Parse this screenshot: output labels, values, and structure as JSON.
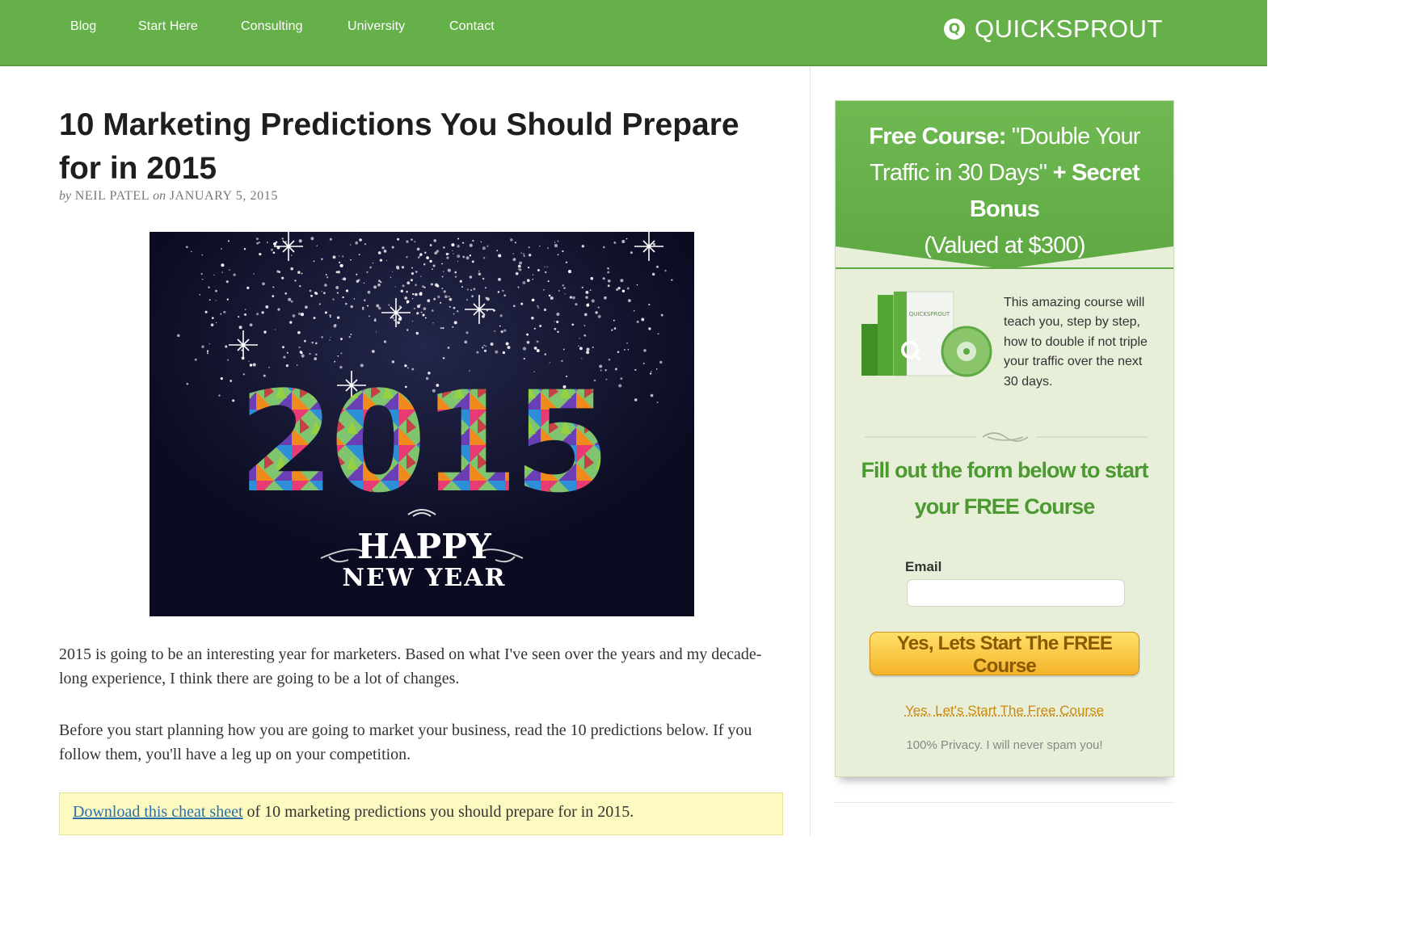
{
  "nav": {
    "items": [
      {
        "label": "Blog"
      },
      {
        "label": "Start Here"
      },
      {
        "label": "Consulting"
      },
      {
        "label": "University"
      },
      {
        "label": "Contact"
      }
    ],
    "logo_mark": "Q",
    "logo_text": "QUICKSPROUT",
    "bar_color": "#66b04a"
  },
  "article": {
    "title": "10 Marketing Predictions You Should Prepare for in 2015",
    "byline": {
      "by": "by",
      "author": "NEIL PATEL",
      "on": "on",
      "date": "JANUARY 5, 2015"
    },
    "hero_image": {
      "year": "2015",
      "line1": "HAPPY",
      "line2": "NEW YEAR"
    },
    "paragraphs": [
      "2015 is going to be an interesting year for marketers. Based on what I've seen over the years and my decade-long experience, I think there are going to be a lot of changes.",
      "Before you start planning how you are going to market your business, read the 10 predictions below. If you follow them, you'll have a leg up on your competition."
    ],
    "cheat_sheet": {
      "link_text": "Download this cheat sheet",
      "rest": " of 10 marketing predictions you should prepare for in 2015."
    }
  },
  "sidebar": {
    "headline": {
      "bold1": "Free Course:",
      "normal1": " \"Double Your Traffic in 30 Days\" ",
      "bold2": "+ Secret Bonus",
      "normal2": "(Valued at $300)"
    },
    "product_label": "QUICKSPROUT",
    "description": "This amazing course will teach you, step by step, how to double if not triple your traffic over the next 30 days.",
    "form_heading": "Fill out the form below to start your FREE Course",
    "email_label": "Email",
    "email_value": "",
    "email_placeholder": "",
    "button_label": "Yes, Lets Start The FREE Course",
    "secondary_link": "Yes, Let's Start The Free Course",
    "privacy": "100% Privacy. I will never spam you!",
    "colors": {
      "header_green": "#66b04a",
      "panel_bg": "#e7efd9",
      "heading_green": "#4a9a30",
      "button_orange": "#f6b32a"
    }
  }
}
